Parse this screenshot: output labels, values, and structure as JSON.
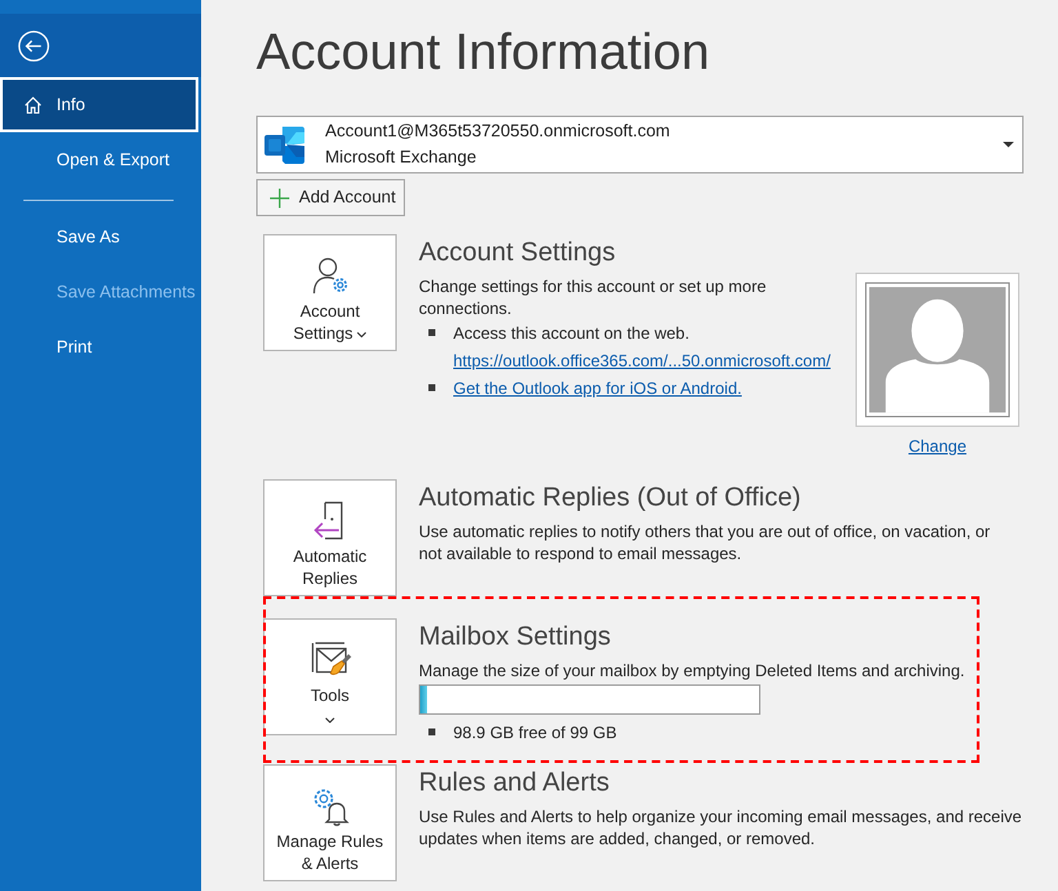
{
  "sidebar": {
    "groups": [
      {
        "items": [
          {
            "label": "Info",
            "selected": true,
            "disabled": false
          },
          {
            "label": "Open & Export",
            "selected": false,
            "disabled": false
          }
        ]
      },
      {
        "items": [
          {
            "label": "Save As",
            "selected": false,
            "disabled": false
          },
          {
            "label": "Save Attachments",
            "selected": false,
            "disabled": true
          },
          {
            "label": "Print",
            "selected": false,
            "disabled": false
          }
        ]
      }
    ]
  },
  "page": {
    "title": "Account Information"
  },
  "account": {
    "email": "Account1@M365t53720550.onmicrosoft.com",
    "type": "Microsoft Exchange"
  },
  "add_account_button": {
    "label": "Add Account"
  },
  "sections": [
    {
      "kind": "account_settings",
      "button": {
        "label": "Account Settings",
        "kind": "inline"
      },
      "heading": "Account Settings",
      "description": "Change settings for this account or set up more connections.",
      "highlighted": false,
      "bullets": [
        {
          "text": "Access this account on the web.",
          "link": "https://outlook.office365.com/...50.onmicrosoft.com/"
        },
        {
          "link": "Get the Outlook app for iOS or Android."
        }
      ],
      "photo": {
        "link": "Change"
      }
    },
    {
      "kind": "automatic_replies",
      "button": {
        "label": "Automatic Replies",
        "kind": "plain"
      },
      "heading": "Automatic Replies (Out of Office)",
      "description": "Use automatic replies to notify others that you are out of office, on vacation, or not available to respond to email messages.",
      "highlighted": false
    },
    {
      "kind": "mailbox",
      "button": {
        "label": "Tools",
        "kind": "stacked"
      },
      "heading": "Mailbox Settings",
      "description": "Manage the size of your mailbox by emptying Deleted Items and archiving.",
      "highlighted": true,
      "quota": {
        "level": 0.02,
        "text": "98.9 GB free of 99 GB"
      }
    },
    {
      "kind": "rules",
      "button": {
        "label": "Manage Rules & Alerts",
        "kind": "plain"
      },
      "heading": "Rules and Alerts",
      "description": "Use Rules and Alerts to help organize your incoming email messages, and receive updates when items are added, changed, or removed.",
      "highlighted": false
    }
  ]
}
